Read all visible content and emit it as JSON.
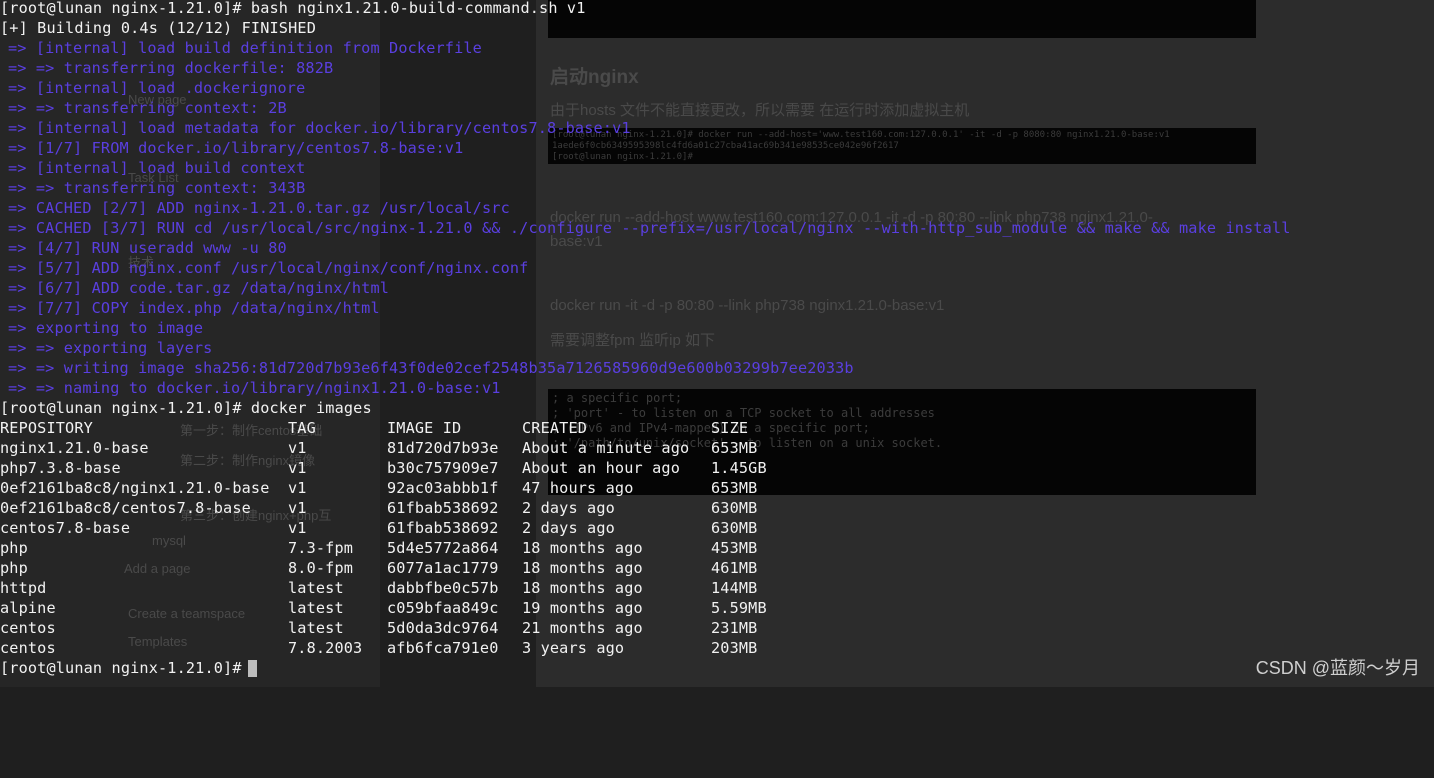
{
  "terminal": {
    "prompt1": "[root@lunan nginx-1.21.0]# bash nginx1.21.0-build-command.sh v1",
    "build_header": "[+] Building 0.4s (12/12) FINISHED",
    "build_steps": [
      "=> [internal] load build definition from Dockerfile",
      "=> => transferring dockerfile: 882B",
      "=> [internal] load .dockerignore",
      "=> => transferring context: 2B",
      "=> [internal] load metadata for docker.io/library/centos7.8-base:v1",
      "=> [1/7] FROM docker.io/library/centos7.8-base:v1",
      "=> [internal] load build context",
      "=> => transferring context: 343B",
      "=> CACHED [2/7] ADD nginx-1.21.0.tar.gz /usr/local/src",
      "=> CACHED [3/7] RUN cd /usr/local/src/nginx-1.21.0 && ./configure --prefix=/usr/local/nginx --with-http_sub_module && make && make install",
      "=> [4/7] RUN useradd www -u 80",
      "=> [5/7] ADD nginx.conf /usr/local/nginx/conf/nginx.conf",
      "=> [6/7] ADD code.tar.gz /data/nginx/html",
      "=> [7/7] COPY index.php /data/nginx/html",
      "=> exporting to image",
      "=> => exporting layers",
      "=> => writing image sha256:81d720d7b93e6f43f0de02cef2548b35a7126585960d9e600b03299b7ee2033b",
      "=> => naming to docker.io/library/nginx1.21.0-base:v1"
    ],
    "prompt2": "[root@lunan nginx-1.21.0]# docker images",
    "images_header": [
      "REPOSITORY",
      "TAG",
      "IMAGE ID",
      "CREATED",
      "SIZE"
    ],
    "images": [
      [
        "nginx1.21.0-base",
        "v1",
        "81d720d7b93e",
        "About a minute ago",
        "653MB"
      ],
      [
        "php7.3.8-base",
        "v1",
        "b30c757909e7",
        "About an hour ago",
        "1.45GB"
      ],
      [
        "0ef2161ba8c8/nginx1.21.0-base",
        "v1",
        "92ac03abbb1f",
        "47 hours ago",
        "653MB"
      ],
      [
        "0ef2161ba8c8/centos7.8-base",
        "v1",
        "61fbab538692",
        "2 days ago",
        "630MB"
      ],
      [
        "centos7.8-base",
        "v1",
        "61fbab538692",
        "2 days ago",
        "630MB"
      ],
      [
        "php",
        "7.3-fpm",
        "5d4e5772a864",
        "18 months ago",
        "453MB"
      ],
      [
        "php",
        "8.0-fpm",
        "6077a1ac1779",
        "18 months ago",
        "461MB"
      ],
      [
        "httpd",
        "latest",
        "dabbfbe0c57b",
        "18 months ago",
        "144MB"
      ],
      [
        "alpine",
        "latest",
        "c059bfaa849c",
        "19 months ago",
        "5.59MB"
      ],
      [
        "centos",
        "latest",
        "5d0da3dc9764",
        "21 months ago",
        "231MB"
      ],
      [
        "centos",
        "7.8.2003",
        "afb6fca791e0",
        "3 years ago",
        "203MB"
      ]
    ],
    "prompt3": "[root@lunan nginx-1.21.0]#"
  },
  "background_doc": {
    "heading": "启动nginx",
    "line1": "由于hosts 文件不能直接更改，所以需要 在运行时添加虚拟主机",
    "shot2_line1": "[root@lunan nginx-1.21.0]# docker run --add-host='www.test160.com:127.0.0.1' -it -d -p 8080:80 nginx1.21.0-base:v1",
    "shot2_line2": "1aede6f0cb6349595398lc4fd6a01c27cba41ac69b341e98535ce042e96f2617",
    "shot2_line3": "[root@lunan nginx-1.21.0]#",
    "cmd1": "docker run --add-host www.test160.com:127.0.0.1 -it -d -p 80:80 --link php738 nginx1.21.0-",
    "cmd1b": "base:v1",
    "cmd2": "docker run -it -d -p 80:80 --link php738 nginx1.21.0-base:v1",
    "line2": "需要调整fpm 监听ip 如下",
    "shot3_lines": [
      ";                          a specific port;",
      ";   'port'                 - to listen on a TCP socket to all addresses",
      ";                          (IPv6 and IPv4-mapped) on a specific port;",
      ";   '/path/to/unix/socket' - to listen on a unix socket."
    ]
  },
  "background_sidebar": {
    "items": [
      "New page",
      "Task List",
      "技术",
      "第一步：制作centos基础",
      "第二步：制作nginx镜像",
      "第三步：创建nginx+php互",
      "mysql",
      "Add a page",
      "Create a teamspace",
      "Templates"
    ]
  },
  "watermark": "CSDN @蓝颜～岁月"
}
